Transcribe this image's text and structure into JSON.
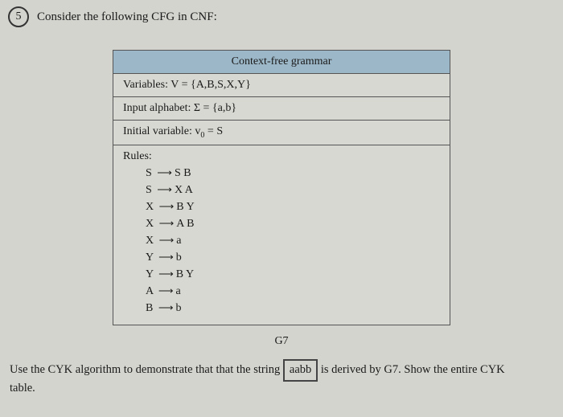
{
  "question": {
    "number": "5",
    "prompt": "Consider the following CFG in CNF:"
  },
  "grammar": {
    "header": "Context-free grammar",
    "variables_label": "Variables: V = {A,B,S,X,Y}",
    "alphabet_label": "Input alphabet: Σ = {a,b}",
    "initial_label_prefix": "Initial variable: v",
    "initial_label_sub": "0",
    "initial_label_suffix": " = S",
    "rules_label": "Rules:",
    "rules": [
      {
        "lhs": "S",
        "rhs": "S B"
      },
      {
        "lhs": "S",
        "rhs": "X A"
      },
      {
        "lhs": "X",
        "rhs": "B Y"
      },
      {
        "lhs": "X",
        "rhs": "A B"
      },
      {
        "lhs": "X",
        "rhs": "a"
      },
      {
        "lhs": "Y",
        "rhs": "b"
      },
      {
        "lhs": "Y",
        "rhs": "B Y"
      },
      {
        "lhs": "A",
        "rhs": "a"
      },
      {
        "lhs": "B",
        "rhs": "b"
      }
    ],
    "caption": "G7"
  },
  "instruction": {
    "prefix": "Use the CYK algorithm to demonstrate that that the string ",
    "boxed": "aabb",
    "suffix": " is derived by G7. Show the entire CYK",
    "line2": "table."
  },
  "arrow_glyph": "⟶"
}
